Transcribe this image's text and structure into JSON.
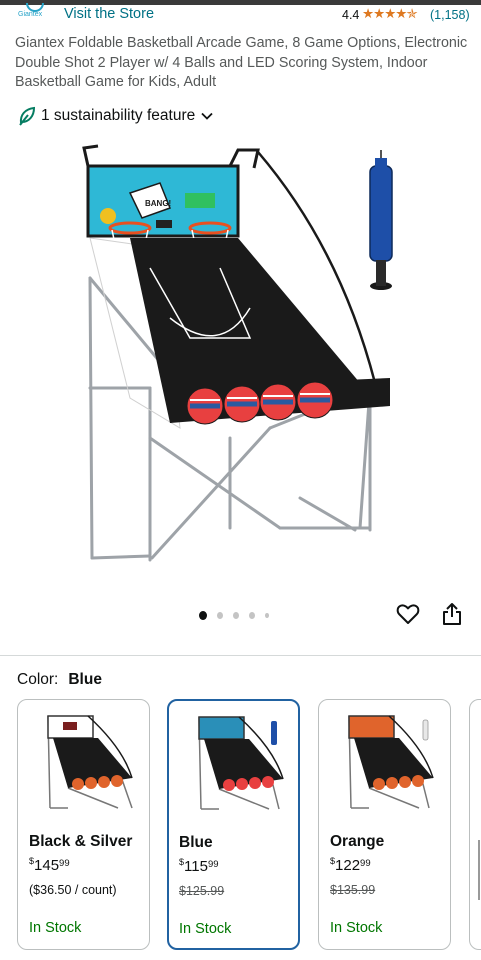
{
  "header": {
    "brand_logo_text": "Giantex",
    "visit_store": "Visit the Store",
    "rating_value": "4.4",
    "rating_stars": "★★★★✯",
    "rating_count": "(1,158)"
  },
  "product": {
    "title": "Giantex Foldable Basketball Arcade Game, 8 Game Options, Electronic Double Shot 2 Player w/ 4 Balls and LED Scoring System, Indoor Basketball Game for Kids, Adult",
    "sustainability_label": "1 sustainability feature",
    "image_count": 5,
    "active_image_index": 0
  },
  "color_selector": {
    "label": "Color:",
    "selected_value": "Blue",
    "options": [
      {
        "name": "Black & Silver",
        "price_whole": "145",
        "price_cents": "99",
        "currency": "$",
        "sub_text": "($36.50 / count)",
        "was_price": "",
        "stock": "In Stock",
        "selected": false,
        "accent": "#7a1f1f"
      },
      {
        "name": "Blue",
        "price_whole": "115",
        "price_cents": "99",
        "currency": "$",
        "sub_text": "",
        "was_price": "$125.99",
        "stock": "In Stock",
        "selected": true,
        "accent": "#2a8fb8"
      },
      {
        "name": "Orange",
        "price_whole": "122",
        "price_cents": "99",
        "currency": "$",
        "sub_text": "",
        "was_price": "$135.99",
        "stock": "In Stock",
        "selected": false,
        "accent": "#e0642c"
      }
    ]
  },
  "colors": {
    "link": "#007185",
    "star": "#de7921",
    "in_stock": "#007600",
    "selected_border": "#2162a1"
  }
}
